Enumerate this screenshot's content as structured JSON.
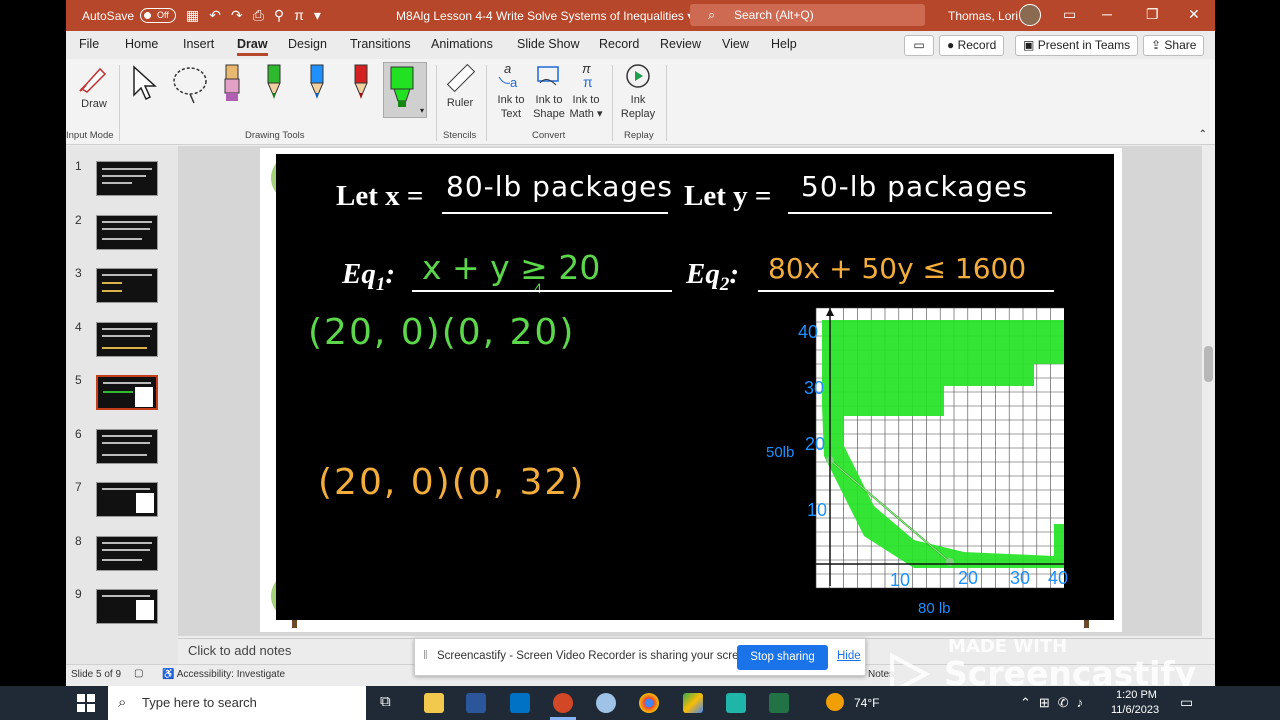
{
  "titlebar": {
    "autosave_label": "AutoSave",
    "autosave_state": "Off",
    "doc_title": "M8Alg Lesson 4-4 Write  Solve Systems of Inequalities",
    "search_placeholder": "Search (Alt+Q)",
    "user_name": "Thomas, Lori"
  },
  "menu": {
    "tabs": [
      "File",
      "Home",
      "Insert",
      "Draw",
      "Design",
      "Transitions",
      "Animations",
      "Slide Show",
      "Record",
      "Review",
      "View",
      "Help"
    ],
    "active_tab": "Draw",
    "record_label": "Record",
    "present_label": "Present in Teams",
    "share_label": "Share"
  },
  "ribbon": {
    "draw_label": "Draw",
    "ruler_label": "Ruler",
    "ink_to_text": [
      "Ink to",
      "Text"
    ],
    "ink_to_shape": [
      "Ink to",
      "Shape"
    ],
    "ink_to_math": [
      "Ink to",
      "Math"
    ],
    "ink_replay": [
      "Ink",
      "Replay"
    ],
    "groups": {
      "input_mode": "Input Mode",
      "drawing_tools": "Drawing Tools",
      "stencils": "Stencils",
      "convert": "Convert",
      "replay": "Replay"
    },
    "pen_colors": [
      "#e3a1c8",
      "#2db82d",
      "#1e90ff",
      "#d42020",
      "#22e022"
    ]
  },
  "thumbnails": [
    "1",
    "2",
    "3",
    "4",
    "5",
    "6",
    "7",
    "8",
    "9"
  ],
  "selected_slide": "5",
  "slide": {
    "let_x_label": "Let x =",
    "let_x_value": "80-lb packages",
    "let_y_label": "Let y =",
    "let_y_value": "50-lb packages",
    "eq1_label": "Eq",
    "eq1_sub": "1",
    "eq1_value": "x + y ≥ 20",
    "eq1_under": "4",
    "eq2_label": "Eq",
    "eq2_sub": "2",
    "eq2_value": "80x + 50y ≤ 1600",
    "points_green": "(20, 0)(0, 20)",
    "points_orange": "(20, 0)(0, 32)",
    "graph": {
      "y_ticks": [
        "40",
        "30",
        "20",
        "10"
      ],
      "x_ticks": [
        "10",
        "20",
        "30",
        "40"
      ],
      "y_note": "50lb",
      "x_note": "80 lb"
    }
  },
  "notes_placeholder": "Click to add notes",
  "status": {
    "slide_info": "Slide 5 of 9",
    "accessibility": "Accessibility: Investigate",
    "notes_label": "Notes"
  },
  "share_banner": {
    "message": "Screencastify - Screen Video Recorder is sharing your screen.",
    "stop_label": "Stop sharing",
    "hide_label": "Hide"
  },
  "watermark": {
    "line1": "MADE WITH",
    "line2": "Screencastify"
  },
  "taskbar": {
    "search_placeholder": "Type here to search",
    "weather": "74°F",
    "time": "1:20 PM",
    "date": "11/6/2023"
  }
}
